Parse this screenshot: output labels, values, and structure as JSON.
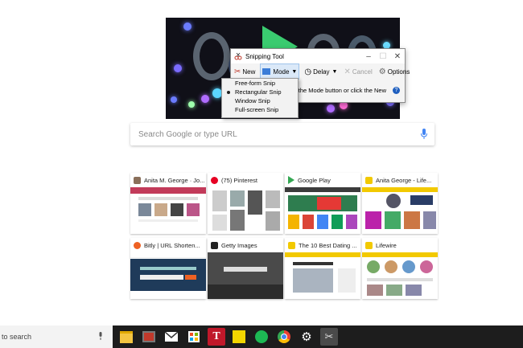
{
  "snipping_tool": {
    "title": "Snipping Tool",
    "window_controls": [
      "–",
      "☐",
      "✕"
    ],
    "toolbar": {
      "new_label": "New",
      "mode_label": "Mode",
      "delay_label": "Delay",
      "cancel_label": "Cancel",
      "options_label": "Options"
    },
    "message": "g the Mode button or click the New",
    "help_symbol": "?"
  },
  "mode_menu": {
    "items": [
      "Free-form Snip",
      "Rectangular Snip",
      "Window Snip",
      "Full-screen Snip"
    ],
    "checked_index": 1
  },
  "search": {
    "placeholder": "Search Google or type URL"
  },
  "tiles": [
    {
      "title": "Anita M. George · Jo..."
    },
    {
      "title": "(75) Pinterest"
    },
    {
      "title": "Google Play"
    },
    {
      "title": "Anita George - Life..."
    },
    {
      "title": "Bitly | URL Shorten..."
    },
    {
      "title": "Getty Images"
    },
    {
      "title": "The 10 Best Dating ..."
    },
    {
      "title": "Lifewire"
    }
  ],
  "taskbar": {
    "search_text": "to search"
  },
  "colors": {
    "pinterest": "#e60023",
    "lifewire": "#f2c900",
    "bitly": "#ee6123",
    "google_play": "#34a853",
    "spotify": "#1db954"
  }
}
